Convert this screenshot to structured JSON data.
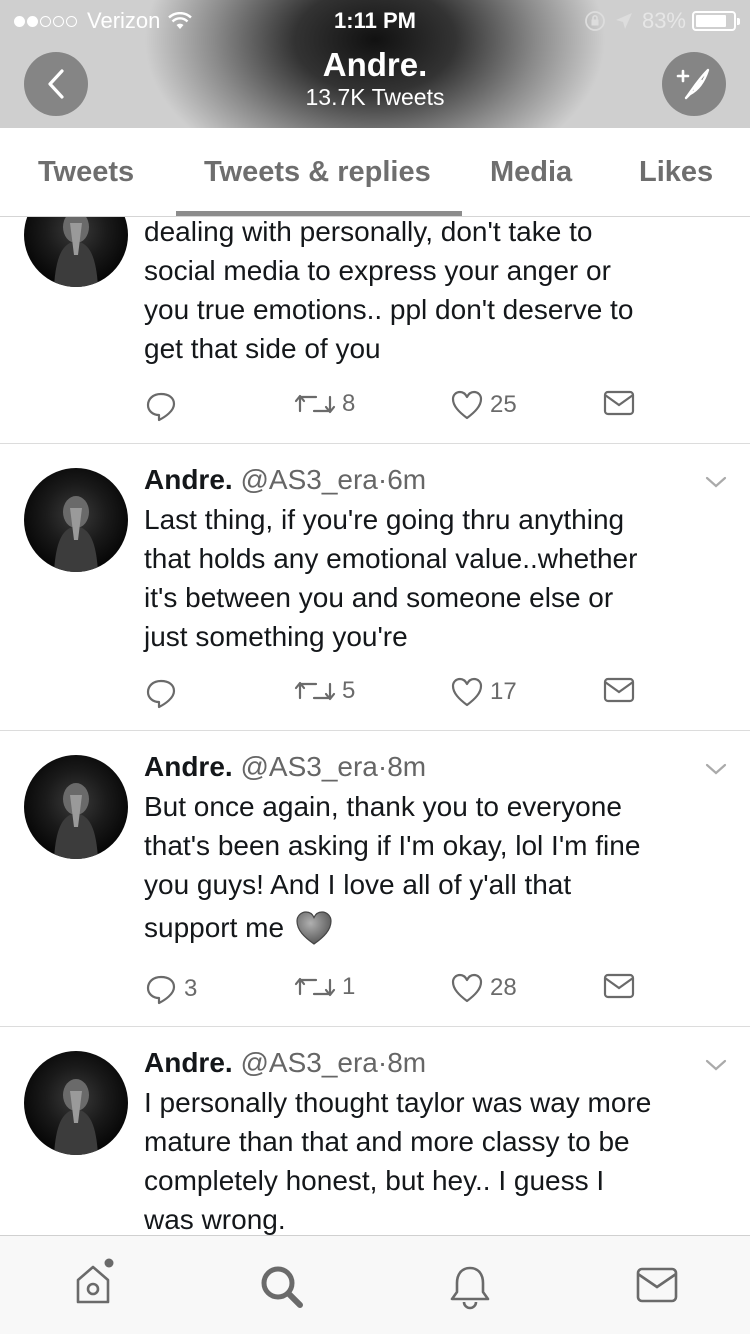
{
  "status_bar": {
    "carrier": "Verizon",
    "time": "1:11 PM",
    "battery": "83%",
    "battery_level": 0.83
  },
  "header": {
    "name": "Andre.",
    "tweet_count": "13.7K Tweets",
    "back_icon": "chevron-left-icon",
    "compose_icon": "compose-tweet-icon"
  },
  "tabs": [
    {
      "label": "Tweets",
      "active": false
    },
    {
      "label": "Tweets & replies",
      "active": true
    },
    {
      "label": "Media",
      "active": false
    },
    {
      "label": "Likes",
      "active": false
    }
  ],
  "tweets": [
    {
      "name": "",
      "handle": "",
      "time": "",
      "text_lines": [
        "dealing with personally, don't take to",
        "social media to express your anger or",
        "you true emotions.. ppl don't deserve to",
        "get that side of you"
      ],
      "replies": "",
      "retweets": "8",
      "likes": "25"
    },
    {
      "name": "Andre.",
      "handle": "@AS3_era",
      "separator": "·",
      "time": "6m",
      "text_lines": [
        "Last thing, if you're going thru anything",
        "that holds any emotional value..whether",
        "it's between you and someone else or",
        "just something you're"
      ],
      "replies": "",
      "retweets": "5",
      "likes": "17"
    },
    {
      "name": "Andre.",
      "handle": "@AS3_era",
      "separator": "·",
      "time": "8m",
      "text_lines": [
        "But once again, thank you to everyone",
        "that's been asking if I'm okay, lol I'm fine",
        "you guys! And I love all of y'all that",
        "support me"
      ],
      "emoji": "grey-heart-emoji",
      "replies": "3",
      "retweets": "1",
      "likes": "28"
    },
    {
      "name": "Andre.",
      "handle": "@AS3_era",
      "separator": "·",
      "time": "8m",
      "text_lines": [
        "I personally thought taylor was way more",
        "mature than that and more classy to be",
        "completely honest, but hey.. I guess I",
        "was wrong."
      ],
      "replies": "",
      "retweets": "",
      "likes": ""
    }
  ],
  "bottom_nav": [
    {
      "icon": "home-icon",
      "badge": true
    },
    {
      "icon": "search-icon"
    },
    {
      "icon": "notifications-bell-icon"
    },
    {
      "icon": "messages-envelope-icon"
    }
  ]
}
